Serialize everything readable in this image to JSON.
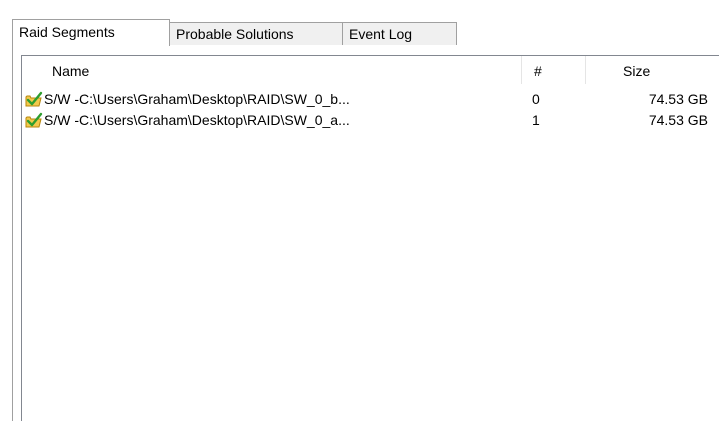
{
  "tabs": [
    {
      "label": "Raid Segments",
      "active": true
    },
    {
      "label": "Probable Solutions",
      "active": false
    },
    {
      "label": "Event Log",
      "active": false
    }
  ],
  "columns": {
    "name": "Name",
    "number": "#",
    "size": "Size"
  },
  "rows": [
    {
      "icon": "folder-check-icon",
      "name": "S/W -C:\\Users\\Graham\\Desktop\\RAID\\SW_0_b...",
      "number": "0",
      "size": "74.53 GB"
    },
    {
      "icon": "folder-check-icon",
      "name": "S/W -C:\\Users\\Graham\\Desktop\\RAID\\SW_0_a...",
      "number": "1",
      "size": "74.53 GB"
    }
  ],
  "colors": {
    "folder": "#f2c94c",
    "check": "#2e9e2e"
  }
}
